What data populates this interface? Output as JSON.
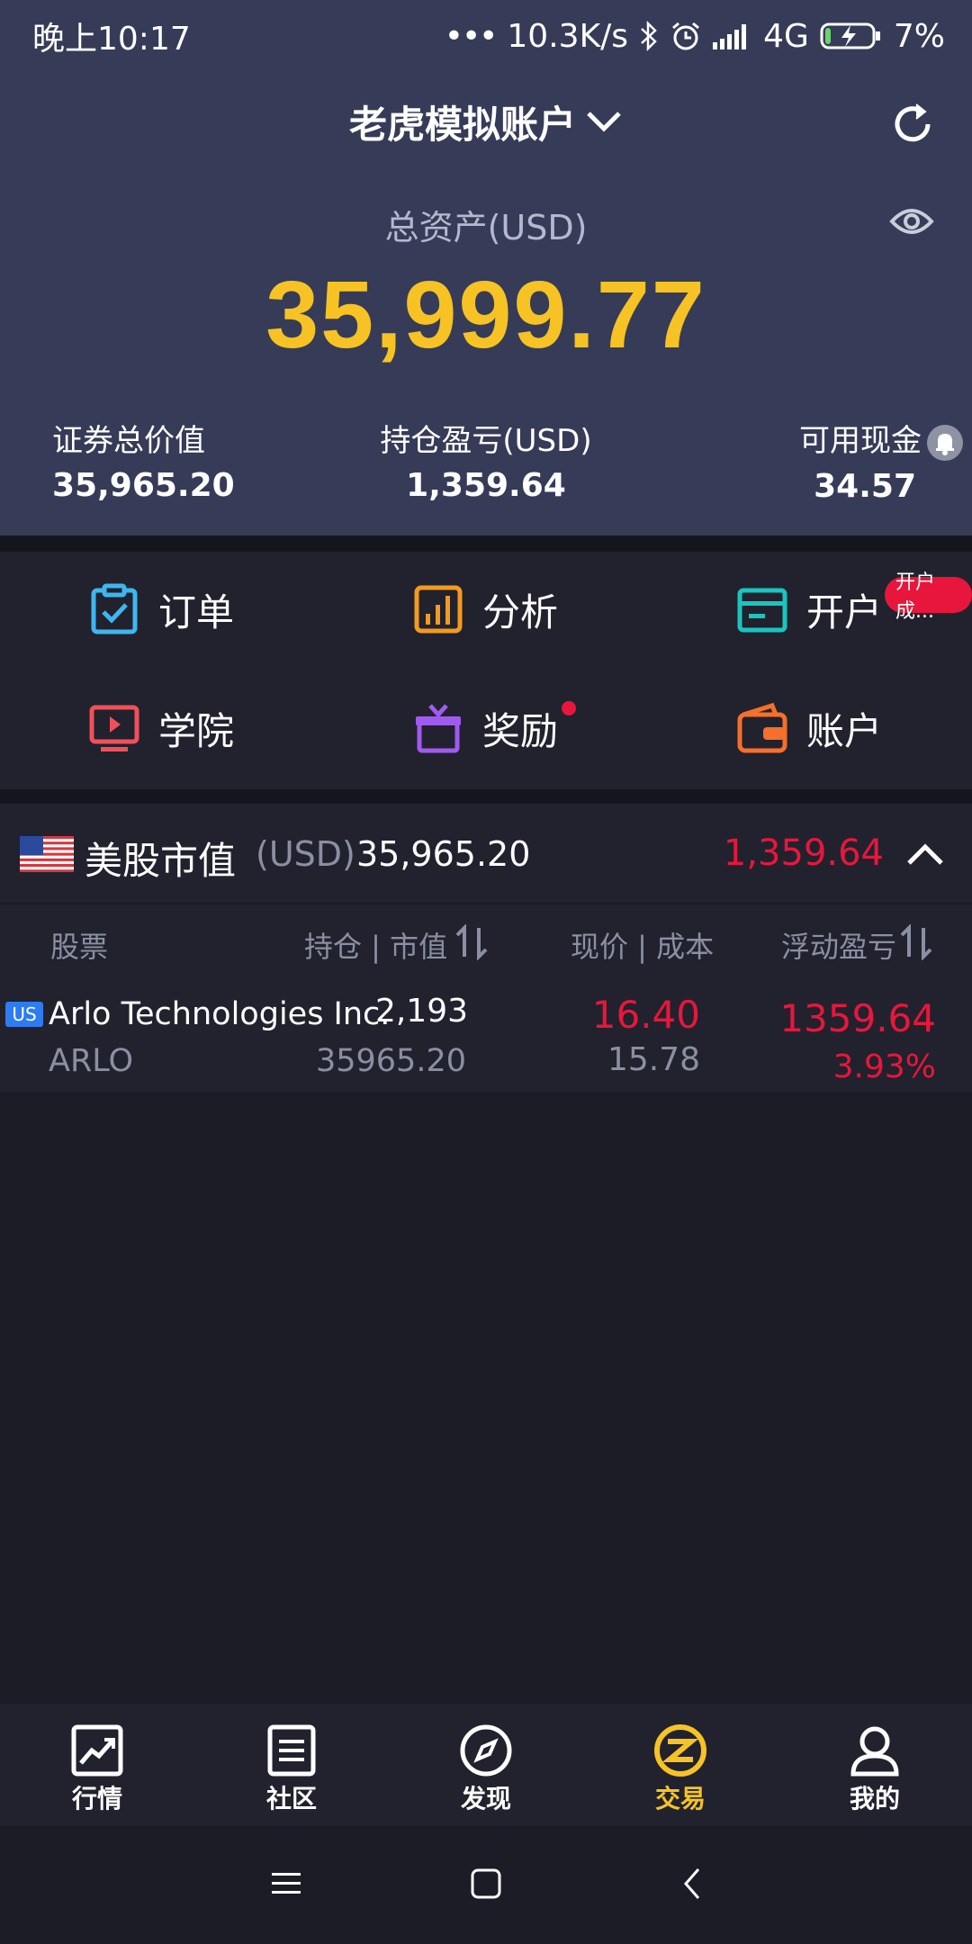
{
  "status_bar": {
    "time": "晚上10:17",
    "speed": "10.3K/s",
    "network": "4G",
    "battery": "7%"
  },
  "header": {
    "account_title": "老虎模拟账户",
    "assets_label": "总资产(USD)",
    "assets_value": "35,999.77"
  },
  "summary": {
    "securities_label": "证券总价值",
    "securities_value": "35,965.20",
    "pl_label": "持仓盈亏(USD)",
    "pl_value": "1,359.64",
    "cash_label": "可用现金",
    "cash_value": "34.57"
  },
  "grid": {
    "orders": "订单",
    "analysis": "分析",
    "open_account": "开户",
    "open_badge": "开户成...",
    "academy": "学院",
    "rewards": "奖励",
    "account": "账户"
  },
  "market": {
    "title": "美股市值",
    "currency": "(USD)",
    "value": "35,965.20",
    "pl": "1,359.64"
  },
  "table": {
    "col_stock": "股票",
    "col_position": "持仓 | 市值",
    "col_price": "现价 | 成本",
    "col_pl": "浮动盈亏",
    "rows": [
      {
        "tag": "US",
        "name": "Arlo Technologies Inc.",
        "symbol": "ARLO",
        "qty": "2,193",
        "market_value": "35965.20",
        "price": "16.40",
        "cost": "15.78",
        "pl": "1359.64",
        "pl_pct": "3.93%"
      }
    ]
  },
  "nav": {
    "market": "行情",
    "community": "社区",
    "discover": "发现",
    "trade": "交易",
    "mine": "我的"
  },
  "colors": {
    "accent_yellow": "#f7c324",
    "loss_red": "#e8163c",
    "panel": "#363c57",
    "background": "#1b1c25"
  }
}
